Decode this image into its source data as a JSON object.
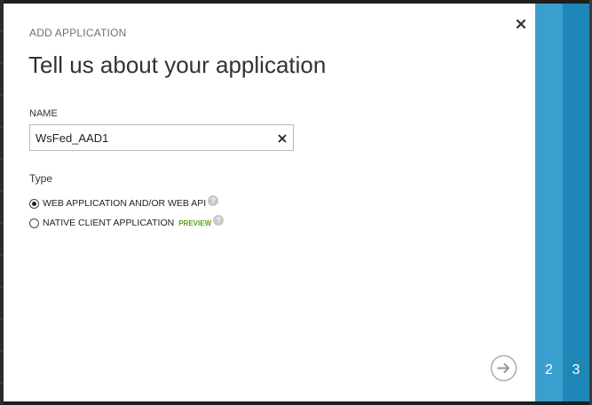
{
  "dialog": {
    "kicker": "ADD APPLICATION",
    "title": "Tell us about your application",
    "close_icon": "close-icon"
  },
  "name_field": {
    "label": "NAME",
    "value": "WsFed_AAD1",
    "clear_icon": "clear-icon"
  },
  "type_section": {
    "label": "Type",
    "options": [
      {
        "label": "WEB APPLICATION AND/OR WEB API",
        "selected": true,
        "help_icon": "question-icon"
      },
      {
        "label": "NATIVE CLIENT APPLICATION",
        "badge": "PREVIEW",
        "selected": false,
        "help_icon": "question-icon"
      }
    ]
  },
  "navigation": {
    "next_icon": "arrow-right-circle-icon"
  },
  "steps": [
    {
      "number": "2",
      "color": "#3a9fce"
    },
    {
      "number": "3",
      "color": "#1f86b8"
    }
  ],
  "colors": {
    "accent_light": "#3a9fce",
    "accent_dark": "#1f86b8",
    "preview_green": "#5aa31e"
  }
}
